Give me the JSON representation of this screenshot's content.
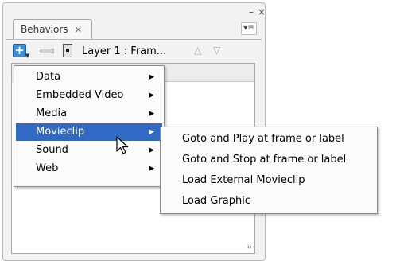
{
  "panel": {
    "tab_label": "Behaviors",
    "tab_close": "×",
    "minimize": "–",
    "close": "×",
    "menu_button": "▾≡",
    "grip": "⠿"
  },
  "toolbar": {
    "add_icon": "+",
    "target_label": "Layer 1 : Fram...",
    "up_arrow": "△",
    "down_arrow": "▽"
  },
  "menu": {
    "items": [
      {
        "label": "Data",
        "arrow": "▶"
      },
      {
        "label": "Embedded Video",
        "arrow": "▶"
      },
      {
        "label": "Media",
        "arrow": "▶"
      },
      {
        "label": "Movieclip",
        "arrow": "▶",
        "highlighted": true
      },
      {
        "label": "Sound",
        "arrow": "▶"
      },
      {
        "label": "Web",
        "arrow": "▶"
      }
    ]
  },
  "submenu": {
    "items": [
      {
        "label": "Goto and Play at frame or label"
      },
      {
        "label": "Goto and Stop at frame or label"
      },
      {
        "label": "Load External Movieclip"
      },
      {
        "label": "Load Graphic"
      }
    ]
  },
  "colors": {
    "highlight": "#316ac5",
    "add_icon": "#3a8fd6"
  }
}
